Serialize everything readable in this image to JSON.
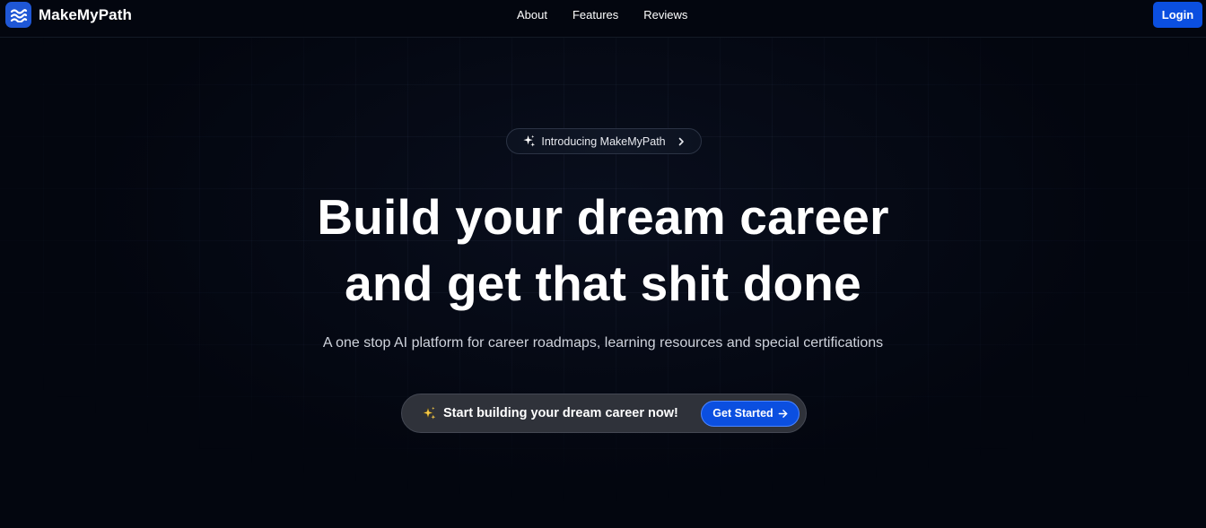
{
  "header": {
    "brand_name": "MakeMyPath",
    "logo_icon": "waves-icon",
    "nav": [
      {
        "label": "About"
      },
      {
        "label": "Features"
      },
      {
        "label": "Reviews"
      }
    ],
    "login_label": "Login"
  },
  "hero": {
    "intro_pill": {
      "icon": "sparkles-icon",
      "label": "Introducing MakeMyPath",
      "trailing_icon": "chevron-right-icon"
    },
    "headline_line1": "Build your dream career",
    "headline_line2": "and get that shit done",
    "subtitle": "A one stop AI platform for career roadmaps, learning resources and special certifications",
    "cta": {
      "icon": "sparkles-emoji-icon",
      "text": "Start building your dream career now!",
      "button_label": "Get Started",
      "button_icon": "arrow-right-icon"
    }
  },
  "colors": {
    "background": "#03060f",
    "accent": "#0b4fe0",
    "cta_bar": "#2f323a"
  }
}
